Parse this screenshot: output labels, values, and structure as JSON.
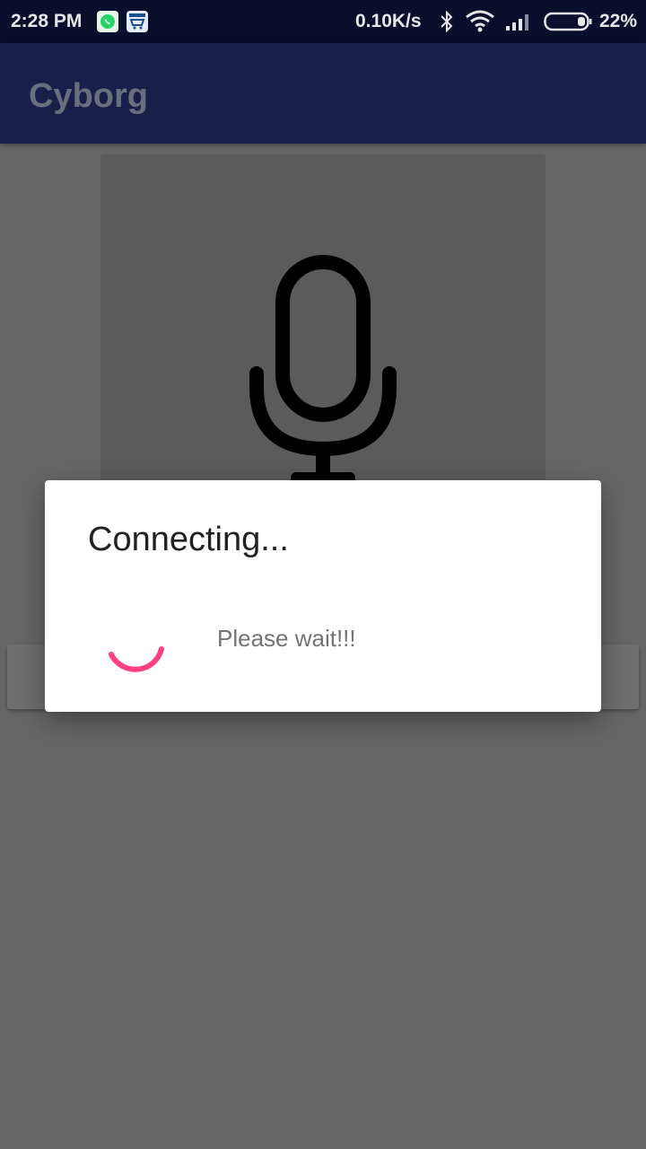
{
  "status_bar": {
    "time": "2:28 PM",
    "net_speed": "0.10K/s",
    "battery": "22%",
    "icons": [
      "whatsapp-icon",
      "cart-app-icon",
      "bluetooth-icon",
      "wifi-icon",
      "signal-icon",
      "battery-icon"
    ]
  },
  "app_bar": {
    "title": "Cyborg"
  },
  "mic_card": {
    "icon": "microphone-icon"
  },
  "dialog": {
    "title": "Connecting...",
    "message": "Please wait!!!",
    "spinner_color": "#ff4081"
  },
  "colors": {
    "status_bar": "#0b0e2a",
    "app_bar": "#1a1f49",
    "scrim_background": "#666666",
    "accent": "#ff4081"
  }
}
